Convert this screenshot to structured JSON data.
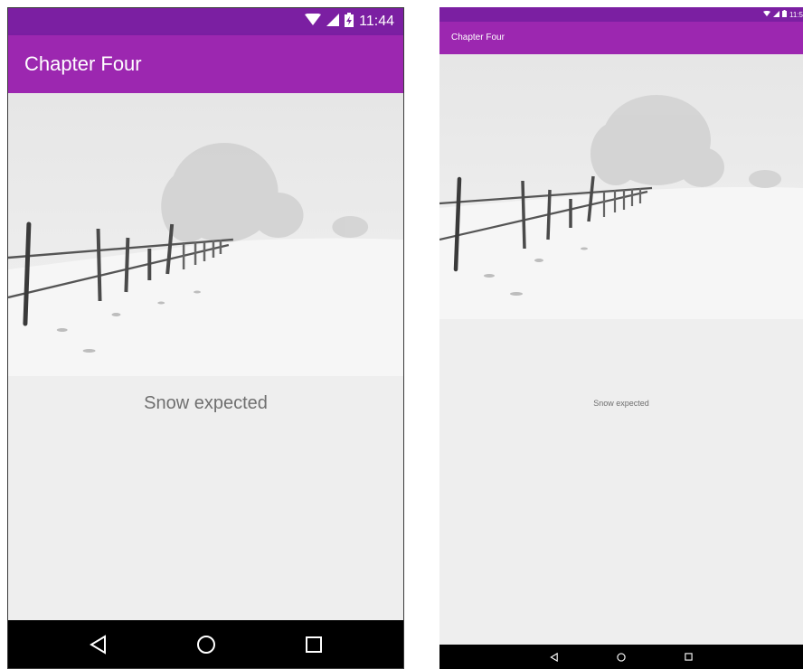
{
  "phone": {
    "status": {
      "time": "11:44",
      "icons": [
        "wifi-icon",
        "signal-icon",
        "battery-charging-icon"
      ]
    },
    "app_title": "Chapter Four",
    "caption": "Snow expected",
    "nav": [
      "back-icon",
      "home-icon",
      "recents-icon"
    ]
  },
  "tablet": {
    "status": {
      "time": "11:5",
      "icons": [
        "wifi-icon",
        "signal-icon",
        "battery-charging-icon"
      ]
    },
    "app_title": "Chapter Four",
    "caption": "Snow expected",
    "nav": [
      "back-icon",
      "home-icon",
      "recents-icon"
    ]
  },
  "colors": {
    "status_bar": "#7b1fa2",
    "app_bar": "#9c27b0",
    "content_bg": "#eeeeee",
    "nav_bar": "#000000",
    "caption_text": "#6f6f6f"
  }
}
